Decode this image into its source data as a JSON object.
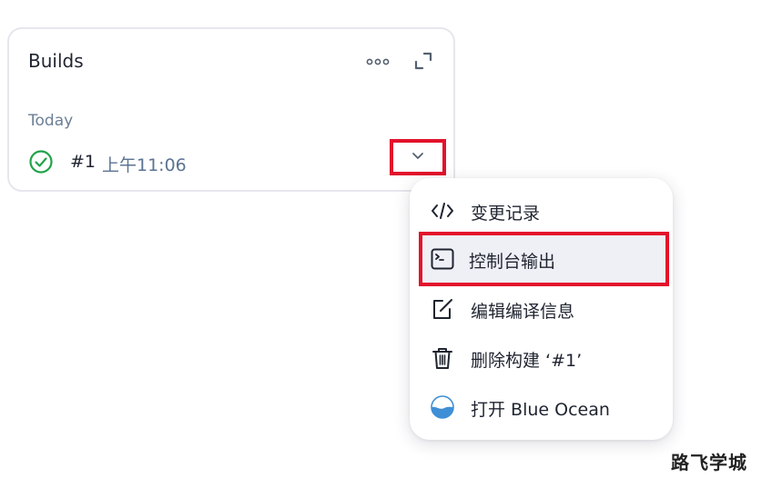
{
  "card": {
    "title": "Builds",
    "section_label": "Today",
    "build": {
      "number": "#1",
      "time": "上午11:06",
      "status": "success"
    }
  },
  "menu": {
    "items": [
      {
        "label": "变更记录",
        "icon": "code-icon"
      },
      {
        "label": "控制台输出",
        "icon": "terminal-icon",
        "highlighted": true
      },
      {
        "label": "编辑编译信息",
        "icon": "edit-icon"
      },
      {
        "label": "删除构建 ‘#1’",
        "icon": "trash-icon"
      },
      {
        "label": "打开 Blue Ocean",
        "icon": "blue-ocean-icon"
      }
    ]
  },
  "watermark": "路飞学城",
  "colors": {
    "highlight": "#e3122c",
    "success": "#22a34a",
    "muted_text": "#6b7f96",
    "blue_ocean": "#3f8fd6"
  }
}
